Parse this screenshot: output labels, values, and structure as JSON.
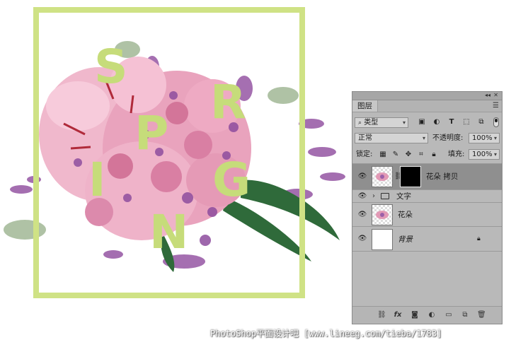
{
  "canvas": {
    "letters": [
      "S",
      "R",
      "P",
      "I",
      "G",
      "N"
    ],
    "frame_color": "#cfe285",
    "letter_color": "#c6dc7a"
  },
  "watermark": "PhotoShop平面设计吧  [www.lineeg.com/tieba/1783]",
  "layers_panel": {
    "tab_label": "图层",
    "filter_select": "类型",
    "filter_icons": [
      "image-filter-icon",
      "adjustment-filter-icon",
      "type-filter-icon",
      "shape-filter-icon",
      "smart-object-filter-icon"
    ],
    "blend_mode": "正常",
    "opacity_label": "不透明度:",
    "opacity_value": "100%",
    "lock_label": "锁定:",
    "fill_label": "填充:",
    "fill_value": "100%",
    "layers": [
      {
        "name": "花朵 拷贝",
        "selected": true,
        "visible": true,
        "kind": "masked-image"
      },
      {
        "name": "文字",
        "selected": false,
        "visible": true,
        "kind": "group"
      },
      {
        "name": "花朵",
        "selected": false,
        "visible": true,
        "kind": "image"
      },
      {
        "name": "背景",
        "selected": false,
        "visible": true,
        "kind": "background",
        "locked": true
      }
    ],
    "bottom_icons": [
      "link-layers-icon",
      "fx-icon",
      "add-mask-icon",
      "adjustment-layer-icon",
      "new-group-icon",
      "new-layer-icon",
      "delete-layer-icon"
    ],
    "bottom_fx_label": "fx"
  }
}
